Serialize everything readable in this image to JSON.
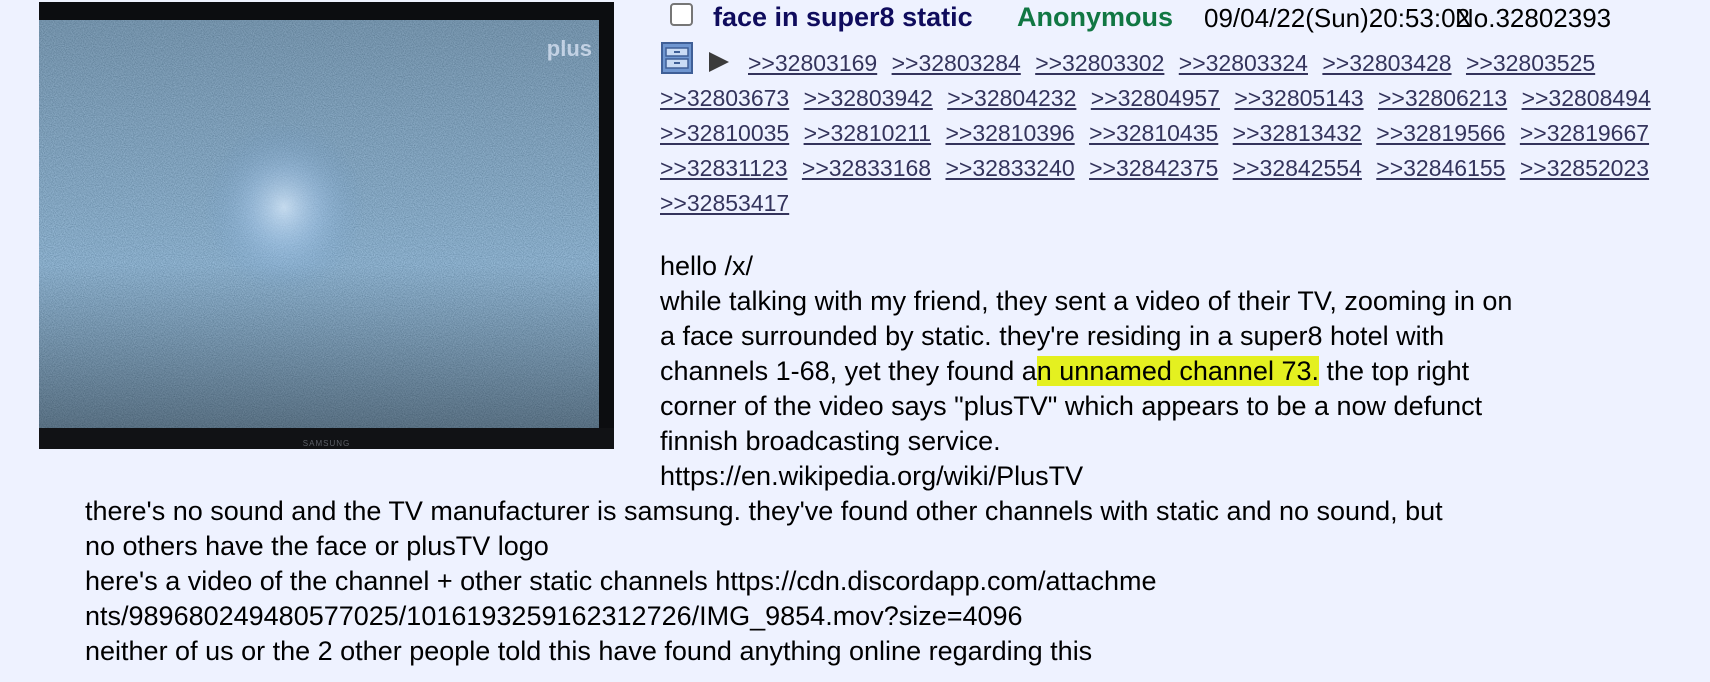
{
  "thumbnail": {
    "logo_text": "plus",
    "brand_text": "SAMSUNG",
    "screen_color": "#3c6a8e",
    "glow_color": "#cfe6ff"
  },
  "post": {
    "subject": "face in super8 static",
    "name": "Anonymous",
    "datetime": "09/04/22(Sun)20:53:02",
    "number": "No.32802393",
    "subject_color": "#0f0c5d",
    "name_color": "#117743"
  },
  "icons": {
    "archive": "archive-icon",
    "play": "play-icon"
  },
  "backlinks": [
    ">>32803169",
    ">>32803284",
    ">>32803302",
    ">>32803324",
    ">>32803428",
    ">>32803525",
    ">>32803673",
    ">>32803942",
    ">>32804232",
    ">>32804957",
    ">>32805143",
    ">>32806213",
    ">>32808494",
    ">>32810035",
    ">>32810211",
    ">>32810396",
    ">>32810435",
    ">>32813432",
    ">>32819566",
    ">>32819667",
    ">>32831123",
    ">>32833168",
    ">>32833240",
    ">>32842375",
    ">>32842554",
    ">>32846155",
    ">>32852023",
    ">>32853417"
  ],
  "body": {
    "greeting": "hello /x/",
    "line1": "while talking with my friend, they sent a video of their TV, zooming in on",
    "line2": "a face surrounded by static. they're residing in a super8 hotel with",
    "line3_pre": "channels 1-68, yet they found a",
    "line3_hl": "n unnamed channel 73.",
    "line3_post": " the top right",
    "line4": "corner of the video says \"plusTV\" which appears to be a now defunct",
    "line5": "finnish broadcasting service.",
    "line6": "https://en.wikipedia.org/wiki/PlusTV",
    "line7": "there's no sound and the TV manufacturer is samsung. they've found other channels with static and no sound, but",
    "line8": "no others have the face or plusTV logo",
    "line9": "here's a video of the channel + other static channels https://cdn.discordapp.com/attachme",
    "line10": "nts/989680249480577025/1016193259162312726/IMG_9854.mov?size=4096",
    "line11": "neither of us or the 2 other people told this have found anything online regarding this",
    "highlight_color": "#e4f020"
  }
}
